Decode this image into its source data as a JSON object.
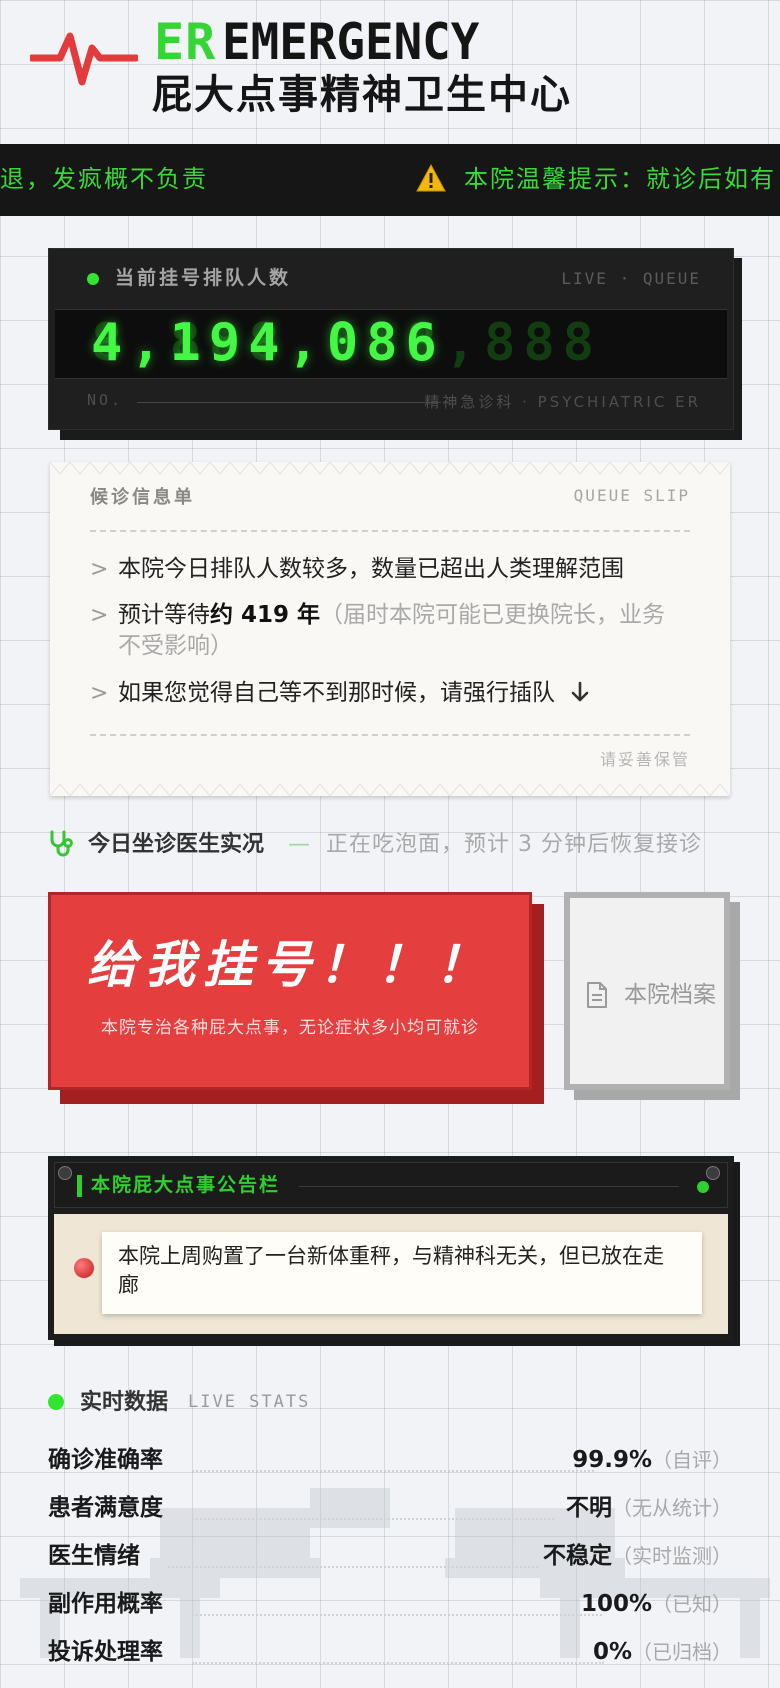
{
  "header": {
    "logo_en_accent": "ER",
    "logo_en_main": "EMERGENCY",
    "hospital_name": "屁大点事精神卫生中心",
    "pulse_icon": "heartbeat-icon"
  },
  "marquee": {
    "text_left": "退，发疯概不负责",
    "warning_icon": "warning-icon",
    "text_right": "本院温馨提示：就诊后如有"
  },
  "counter": {
    "title": "当前挂号排队人数",
    "live_label": "LIVE · QUEUE",
    "ghost_digits": "8,888,888,888",
    "value": "4,194,086",
    "no_label": "NO.",
    "footer": "精神急诊科 · PSYCHIATRIC ER"
  },
  "slip": {
    "title": "候诊信息单",
    "title_en": "QUEUE SLIP",
    "line1": "本院今日排队人数较多，数量已超出人类理解范围",
    "line2_prefix": "预计等待",
    "line2_strong": "约 419 年",
    "line2_note": "（届时本院可能已更换院长，业务不受影响）",
    "line3": "如果您觉得自己等不到那时候，请强行插队",
    "arrow_icon": "arrow-down-icon",
    "keep_note": "请妥善保管"
  },
  "doctor": {
    "icon": "stethoscope-icon",
    "title": "今日坐诊医生实况",
    "dash": "—",
    "status": "正在吃泡面，预计 3 分钟后恢复接诊"
  },
  "register": {
    "title": "给我挂号！！！",
    "subtitle": "本院专治各种屁大点事，无论症状多小均可就诊"
  },
  "archive": {
    "icon": "document-icon",
    "label": "本院档案"
  },
  "board": {
    "title": "本院屁大点事公告栏",
    "notice": "本院上周购置了一台新体重秤，与精神科无关，但已放在走廊"
  },
  "stats": {
    "title": "实时数据",
    "title_en": "LIVE STATS",
    "rows": [
      {
        "label": "确诊准确率",
        "value": "99.9%",
        "note": "（自评）"
      },
      {
        "label": "患者满意度",
        "value": "不明",
        "note": "（无从统计）"
      },
      {
        "label": "医生情绪",
        "value": "不稳定",
        "note": "（实时监测）"
      },
      {
        "label": "副作用概率",
        "value": "100%",
        "note": "（已知）"
      },
      {
        "label": "投诉处理率",
        "value": "0%",
        "note": "（已归档）"
      }
    ]
  },
  "colors": {
    "accent_green": "#34d534",
    "alert_red": "#e43e3e",
    "dark": "#1d1d1d"
  }
}
